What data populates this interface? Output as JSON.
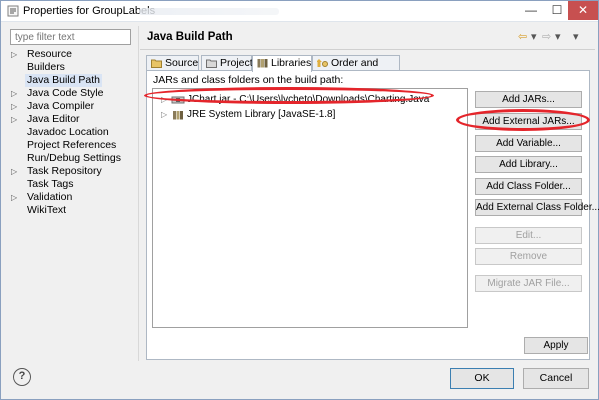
{
  "window": {
    "title": "Properties for GroupLabels",
    "controls": {
      "minimize": "—",
      "maximize": "☐",
      "close": "✕"
    }
  },
  "sidebar": {
    "filter_placeholder": "type filter text",
    "items": [
      {
        "label": "Resource",
        "expandable": true
      },
      {
        "label": "Builders",
        "expandable": false
      },
      {
        "label": "Java Build Path",
        "expandable": false,
        "selected": true
      },
      {
        "label": "Java Code Style",
        "expandable": true
      },
      {
        "label": "Java Compiler",
        "expandable": true
      },
      {
        "label": "Java Editor",
        "expandable": true
      },
      {
        "label": "Javadoc Location",
        "expandable": false
      },
      {
        "label": "Project References",
        "expandable": false
      },
      {
        "label": "Run/Debug Settings",
        "expandable": false
      },
      {
        "label": "Task Repository",
        "expandable": true
      },
      {
        "label": "Task Tags",
        "expandable": false
      },
      {
        "label": "Validation",
        "expandable": true
      },
      {
        "label": "WikiText",
        "expandable": false
      }
    ]
  },
  "page": {
    "title": "Java Build Path",
    "nav": {
      "back": "⇦",
      "back_menu": "▾",
      "forward": "⇨",
      "forward_menu": "▾",
      "view_menu": "▾"
    }
  },
  "tabs": [
    {
      "label": "Source",
      "active": false,
      "icon": "source-folder-icon"
    },
    {
      "label": "Projects",
      "active": false,
      "icon": "projects-icon"
    },
    {
      "label": "Libraries",
      "active": true,
      "icon": "libraries-icon"
    },
    {
      "label": "Order and Export",
      "active": false,
      "icon": "order-export-icon"
    }
  ],
  "libraries": {
    "label": "JARs and class folders on the build path:",
    "entries": [
      {
        "text": "JChart.jar - C:\\Users\\lvcheto\\Downloads\\Charting.Java",
        "icon": "jar-icon"
      },
      {
        "text": "JRE System Library [JavaSE-1.8]",
        "icon": "library-icon"
      }
    ]
  },
  "buttons": {
    "add_jars": "Add JARs...",
    "add_external_jars": "Add External JARs...",
    "add_variable": "Add Variable...",
    "add_library": "Add Library...",
    "add_class_folder": "Add Class Folder...",
    "add_external_class_folder": "Add External Class Folder...",
    "edit": "Edit...",
    "remove": "Remove",
    "migrate_jar": "Migrate JAR File...",
    "apply": "Apply",
    "ok": "OK",
    "cancel": "Cancel",
    "help": "?"
  },
  "colors": {
    "annotation": "#e4252b",
    "selection": "#d9e4f4"
  }
}
